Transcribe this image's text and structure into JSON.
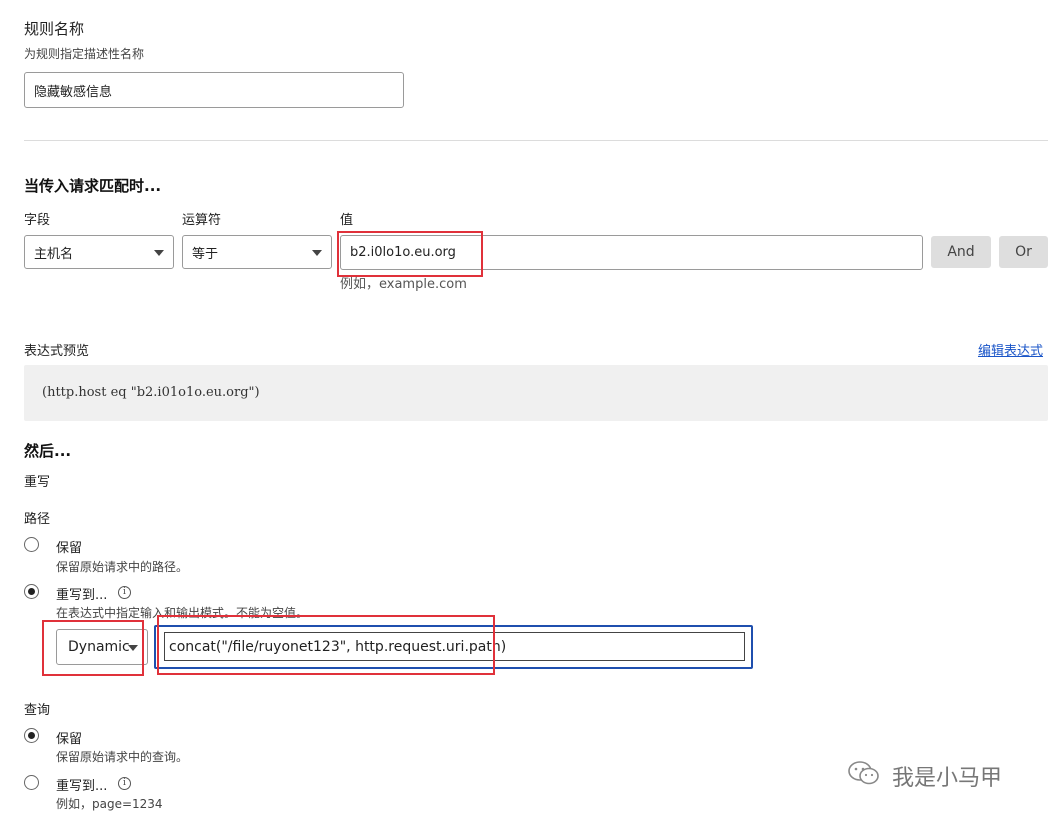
{
  "rule_name": {
    "title": "规则名称",
    "description": "为规则指定描述性名称",
    "value": "隐藏敏感信息"
  },
  "match": {
    "heading": "当传入请求匹配时...",
    "field_label": "字段",
    "operator_label": "运算符",
    "value_label": "值",
    "field_value": "主机名",
    "operator_value": "等于",
    "value_input": "b2.i0lo1o.eu.org",
    "value_hint": "例如，example.com",
    "and_button": "And",
    "or_button": "Or"
  },
  "expression": {
    "label": "表达式预览",
    "edit_link": "编辑表达式",
    "preview": "(http.host eq \"b2.i01o1o.eu.org\")"
  },
  "then": {
    "heading": "然后...",
    "action": "重写"
  },
  "path": {
    "label": "路径",
    "preserve_label": "保留",
    "preserve_desc": "保留原始请求中的路径。",
    "rewrite_label": "重写到...",
    "rewrite_desc": "在表达式中指定输入和输出模式。不能为空值。",
    "mode": "Dynamic",
    "expression_value": "concat(\"/file/ruyonet123\", http.request.uri.path)"
  },
  "query": {
    "label": "查询",
    "preserve_label": "保留",
    "preserve_desc": "保留原始请求中的查询。",
    "rewrite_label": "重写到...",
    "rewrite_hint": "例如，page=1234"
  },
  "watermark": {
    "text": "我是小马甲"
  },
  "colors": {
    "accent_link": "#1a55c8",
    "highlight_red": "#e0313a",
    "focus_blue": "#1f4fae",
    "preview_bg": "#f0f0f0"
  }
}
